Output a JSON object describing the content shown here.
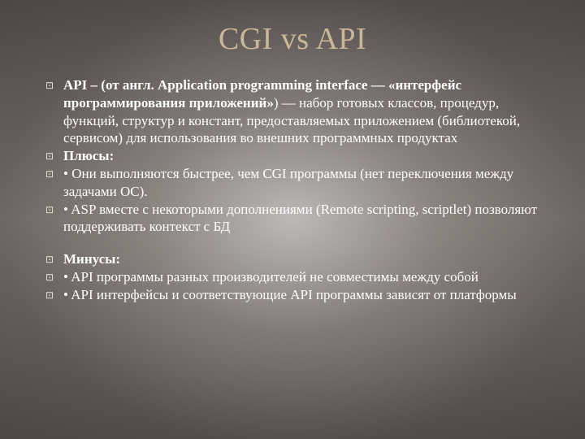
{
  "title": "CGI vs API",
  "group1": [
    {
      "bold": "API – (от англ. Application programming interface — «интерфейс программирования приложений»",
      "rest": ") — набор готовых классов, процедур, функций, структур и констант, предоставляемых приложением (библиотекой, сервисом) для использования во внешних программных продуктах"
    },
    {
      "plain": "Плюсы:",
      "boldAll": true
    },
    {
      "plain": "• Они выполняются быстрее, чем CGI программы (нет переключения между задачами OC)."
    },
    {
      "plain": "• ASP вместе с некоторыми дополнениями (Remote scripting, scriptlet) позволяют поддерживать контекст с БД"
    }
  ],
  "group2": [
    {
      "plain": "Минусы:",
      "boldAll": true
    },
    {
      "plain": "• API программы разных производителей не совместимы между собой"
    },
    {
      "plain": "• API интерфейсы и соответствующие API программы зависят от платформы"
    }
  ],
  "bulletGlyph": "⊡"
}
